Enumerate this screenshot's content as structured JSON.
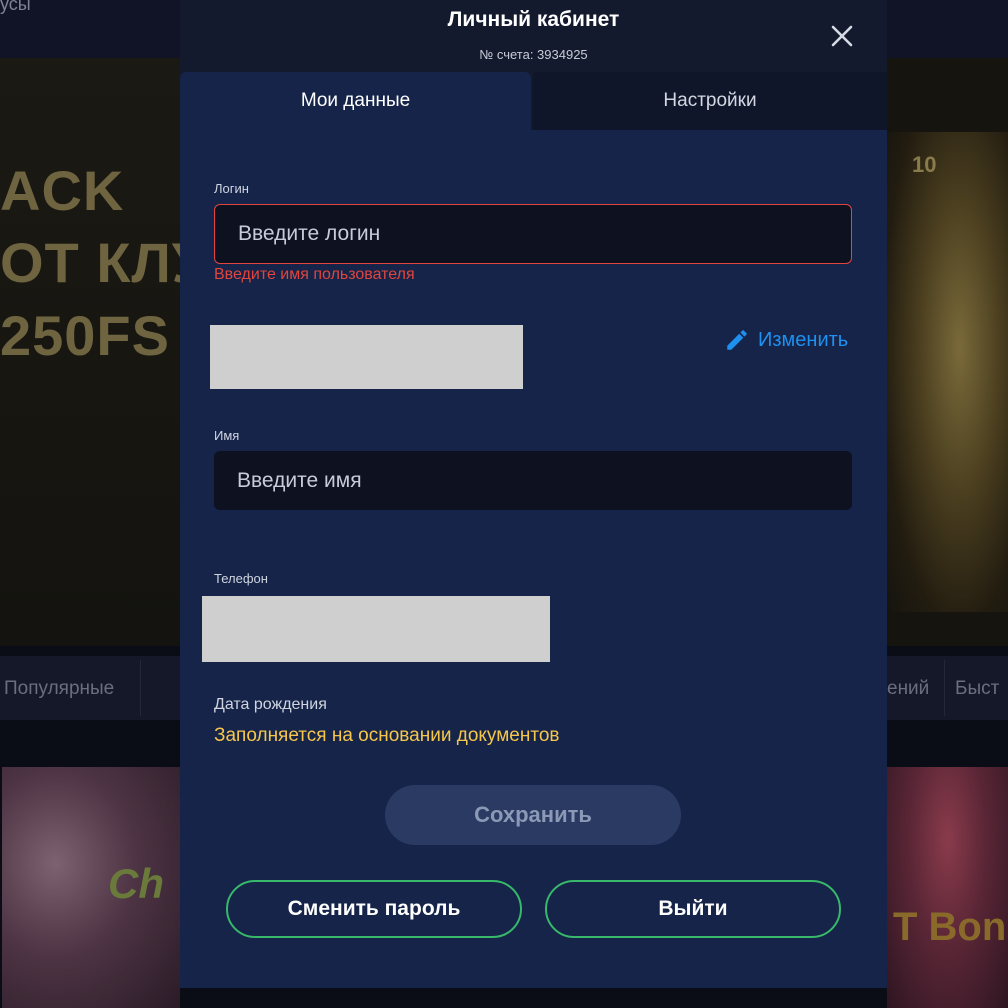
{
  "background": {
    "topbar_text": "усы",
    "promo_lines": [
      "ACK",
      "ОТ КЛУ",
      "250FS"
    ],
    "lion_badge": "10",
    "categories": [
      "Популярные",
      "ений",
      "Быст"
    ],
    "game_left_text": "Ch",
    "game_right_text": "T Bon"
  },
  "modal": {
    "title": "Личный кабинет",
    "account_number": "№ счета: 3934925",
    "close_icon": "close-icon",
    "tabs": [
      {
        "label": "Мои данные",
        "active": true
      },
      {
        "label": "Настройки",
        "active": false
      }
    ],
    "login": {
      "label": "Логин",
      "placeholder": "Введите логин",
      "value": "",
      "error": "Введите имя пользователя"
    },
    "edit": {
      "label": "Изменить",
      "icon": "pencil-icon"
    },
    "name": {
      "label": "Имя",
      "placeholder": "Введите имя",
      "value": ""
    },
    "phone": {
      "label": "Телефон"
    },
    "dob": {
      "label": "Дата рождения",
      "value": "Заполняется на основании документов"
    },
    "buttons": {
      "save": "Сохранить",
      "change_password": "Сменить пароль",
      "logout": "Выйти"
    }
  },
  "colors": {
    "panel": "#152448",
    "error": "#e1453d",
    "link": "#1e90f0",
    "highlight": "#f5c64a",
    "outline_green": "#37b86a"
  }
}
